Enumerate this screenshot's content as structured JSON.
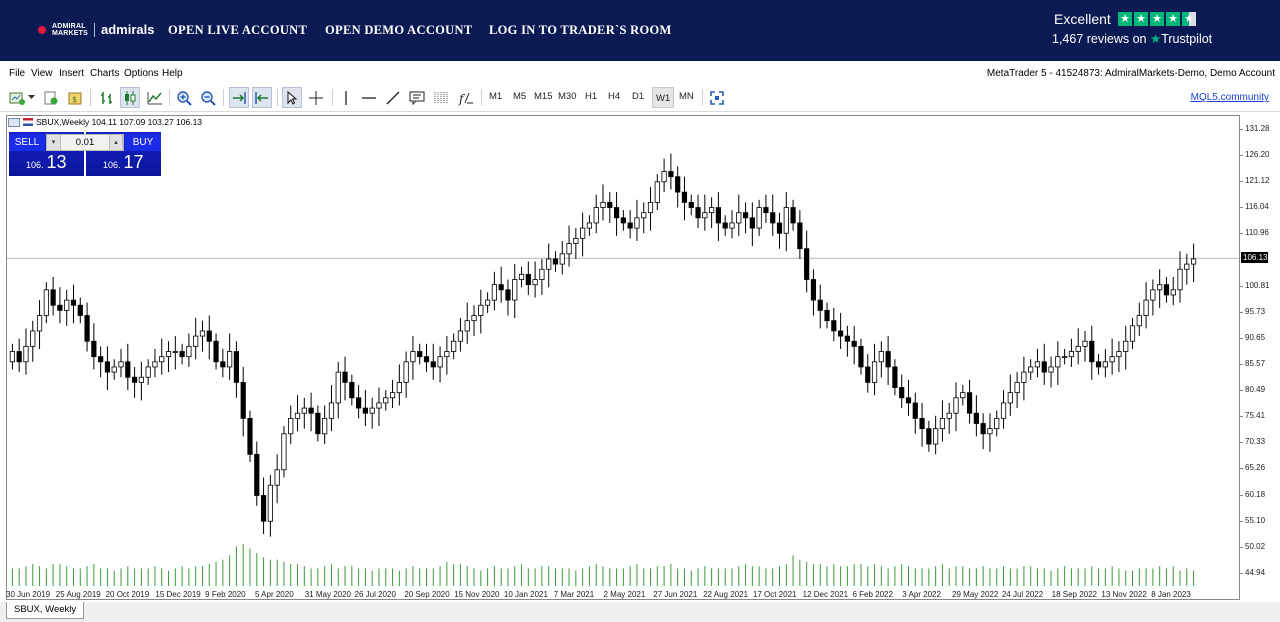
{
  "site": {
    "logo_small": "ADMIRAL\nMARKETS",
    "logo_text": "admirals",
    "nav": [
      "OPEN LIVE ACCOUNT",
      "OPEN DEMO ACCOUNT",
      "LOG IN TO TRADER`S ROOM"
    ],
    "trustpilot": {
      "rating_text": "Excellent",
      "reviews": "1,467 reviews on",
      "brand": "Trustpilot",
      "stars": 4.5
    }
  },
  "menu": [
    "File",
    "View",
    "Insert",
    "Charts",
    "Options",
    "Help"
  ],
  "server_info": "MetaTrader 5 - 41524873: AdmiralMarkets-Demo, Demo Account",
  "toolbar": {
    "icons": [
      "new-chart-icon",
      "dropdown-arrow-icon",
      "profiles-icon",
      "templates-icon",
      "bar-chart-icon",
      "candlestick-icon",
      "line-chart-icon",
      "zoom-in-icon",
      "zoom-out-icon",
      "autoscroll-icon",
      "chart-shift-icon",
      "cursor-icon",
      "crosshair-icon",
      "vertical-line-icon",
      "horizontal-line-icon",
      "trendline-icon",
      "text-icon",
      "fibonacci-icon",
      "indicators-icon",
      "fullscreen-icon"
    ],
    "timeframes": [
      "M1",
      "M5",
      "M15",
      "M30",
      "H1",
      "H4",
      "D1",
      "W1",
      "MN"
    ],
    "active_timeframe": "W1",
    "mql_link": "MQL5.community"
  },
  "chart": {
    "header": "SBUX,Weekly  104.11 107.09 103.27 106.13",
    "sell_label": "SELL",
    "buy_label": "BUY",
    "lot": "0.01",
    "sell_price_prefix": "106.",
    "sell_price_big": "13",
    "buy_price_prefix": "106.",
    "buy_price_big": "17",
    "current_price": "106.13",
    "tab": "SBUX, Weekly",
    "price_labels": [
      "131.28",
      "126.20",
      "121.12",
      "116.04",
      "110.96",
      "100.81",
      "95.73",
      "90.65",
      "85.57",
      "80.49",
      "75.41",
      "70.33",
      "65.26",
      "60.18",
      "55.10",
      "50.02",
      "44.94"
    ],
    "time_labels": [
      "30 Jun 2019",
      "25 Aug 2019",
      "20 Oct 2019",
      "15 Dec 2019",
      "9 Feb 2020",
      "5 Apr 2020",
      "31 May 2020",
      "26 Jul 2020",
      "20 Sep 2020",
      "15 Nov 2020",
      "10 Jan 2021",
      "7 Mar 2021",
      "2 May 2021",
      "27 Jun 2021",
      "22 Aug 2021",
      "17 Oct 2021",
      "12 Dec 2021",
      "6 Feb 2022",
      "3 Apr 2022",
      "29 May 2022",
      "24 Jul 2022",
      "18 Sep 2022",
      "13 Nov 2022",
      "8 Jan 2023"
    ]
  },
  "chart_data": {
    "type": "candlestick",
    "symbol": "SBUX",
    "period": "Weekly",
    "ylim": [
      42.4,
      133.8
    ],
    "last": {
      "open": 104.11,
      "high": 107.09,
      "low": 103.27,
      "close": 106.13
    },
    "close": [
      88,
      86,
      89,
      92,
      95,
      100,
      97,
      96,
      98,
      97,
      95,
      90,
      87,
      86,
      84,
      85,
      86,
      83,
      82,
      83,
      85,
      86,
      87,
      88,
      88,
      87,
      89,
      91,
      92,
      90,
      86,
      85,
      88,
      82,
      75,
      68,
      60,
      55,
      62,
      65,
      72,
      75,
      76,
      77,
      76,
      72,
      75,
      78,
      84,
      82,
      79,
      77,
      76,
      77,
      78,
      79,
      80,
      82,
      86,
      88,
      87,
      86,
      85,
      87,
      88,
      90,
      92,
      94,
      95,
      97,
      98,
      101,
      100,
      98,
      102,
      103,
      101,
      102,
      104,
      106,
      105,
      107,
      109,
      110,
      112,
      113,
      116,
      117,
      116,
      114,
      113,
      112,
      114,
      115,
      117,
      121,
      123,
      122,
      119,
      117,
      116,
      114,
      115,
      116,
      113,
      112,
      113,
      115,
      114,
      112,
      116,
      115,
      113,
      111,
      116,
      113,
      108,
      102,
      98,
      96,
      94,
      92,
      91,
      90,
      89,
      85,
      82,
      86,
      88,
      85,
      81,
      79,
      78,
      75,
      73,
      70,
      73,
      75,
      76,
      79,
      80,
      76,
      74,
      72,
      73,
      75,
      78,
      80,
      82,
      84,
      85,
      86,
      84,
      85,
      87,
      87,
      88,
      89,
      90,
      86,
      85,
      86,
      87,
      88,
      90,
      93,
      95,
      98,
      100,
      101,
      99,
      100,
      104,
      105,
      106
    ]
  },
  "volume": [
    8,
    8,
    9,
    10,
    9,
    8,
    10,
    10,
    9,
    8,
    8,
    9,
    10,
    8,
    8,
    7,
    8,
    9,
    8,
    8,
    8,
    9,
    8,
    7,
    8,
    9,
    8,
    9,
    9,
    10,
    11,
    12,
    14,
    18,
    19,
    17,
    15,
    13,
    12,
    12,
    11,
    10,
    10,
    9,
    8,
    8,
    9,
    10,
    8,
    9,
    9,
    8,
    8,
    7,
    8,
    8,
    8,
    7,
    8,
    9,
    8,
    8,
    8,
    9,
    11,
    10,
    10,
    9,
    8,
    7,
    8,
    9,
    8,
    8,
    9,
    10,
    8,
    8,
    9,
    9,
    8,
    8,
    8,
    7,
    8,
    9,
    10,
    9,
    8,
    8,
    8,
    9,
    10,
    8,
    8,
    9,
    9,
    10,
    8,
    8,
    7,
    8,
    9,
    8,
    8,
    8,
    8,
    9,
    10,
    9,
    9,
    8,
    8,
    9,
    10,
    14,
    12,
    11,
    10,
    10,
    9,
    10,
    9,
    9,
    10,
    10,
    9,
    10,
    9,
    8,
    9,
    10,
    9,
    8,
    8,
    8,
    9,
    10,
    8,
    9,
    9,
    8,
    8,
    9,
    8,
    8,
    9,
    8,
    8,
    9,
    9,
    8,
    8,
    7,
    8,
    9,
    8,
    8,
    8,
    9,
    8,
    8,
    9,
    8,
    7,
    7,
    8,
    8,
    8,
    9,
    8,
    9,
    7,
    8,
    7
  ]
}
